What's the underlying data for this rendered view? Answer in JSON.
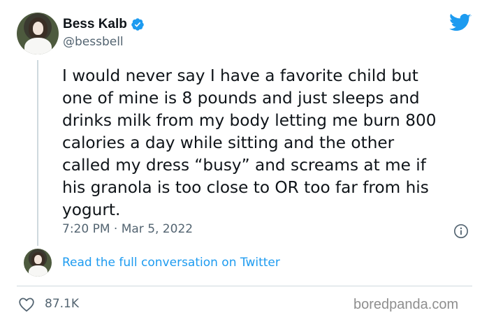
{
  "author": {
    "display_name": "Bess Kalb",
    "handle": "@bessbell"
  },
  "tweet": {
    "text": "I would never say I have a favorite child but\none of mine is 8 pounds and just sleeps and\ndrinks milk from my body letting me burn 800\ncalories a day while sitting and the other\ncalled my dress “busy” and screams at me if\nhis granola is too close to OR too far from his\nyogurt.",
    "timestamp": "7:20 PM · Mar 5, 2022"
  },
  "conversation_link": "Read the full conversation on Twitter",
  "likes": "87.1K",
  "watermark": "boredpanda.com",
  "icons": {
    "verified": "verified-badge-icon",
    "brand": "twitter-bird-icon",
    "info": "info-icon",
    "like": "heart-icon"
  },
  "colors": {
    "link": "#1d9bf0",
    "secondary_text": "#536471",
    "twitter_blue": "#1d9bf0"
  }
}
